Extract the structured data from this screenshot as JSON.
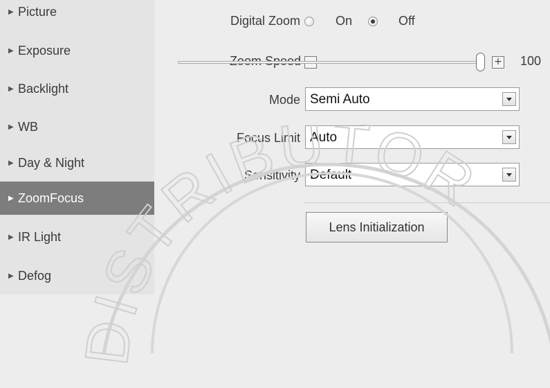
{
  "sidebar": {
    "items": [
      {
        "label": "Picture"
      },
      {
        "label": "Exposure"
      },
      {
        "label": "Backlight"
      },
      {
        "label": "WB"
      },
      {
        "label": "Day & Night"
      },
      {
        "label": "ZoomFocus",
        "active": true
      },
      {
        "label": "IR Light"
      },
      {
        "label": "Defog"
      }
    ]
  },
  "form": {
    "digital_zoom": {
      "label": "Digital Zoom",
      "options": [
        "On",
        "Off"
      ],
      "selected": "Off"
    },
    "zoom_speed": {
      "label": "Zoom Speed",
      "minus": "−",
      "plus": "+",
      "value": "100"
    },
    "mode": {
      "label": "Mode",
      "value": "Semi Auto"
    },
    "focus_limit": {
      "label": "Focus Limit",
      "value": "Auto"
    },
    "sensitivity": {
      "label": "Sensitivity",
      "value": "Default"
    },
    "lens_button": "Lens Initialization"
  },
  "watermark": {
    "text": "DISTRIBUTOR"
  },
  "colors": {
    "sidebar_bg": "#e4e4e4",
    "active_item": "#7d7d7d",
    "panel_bg": "#ededed"
  }
}
